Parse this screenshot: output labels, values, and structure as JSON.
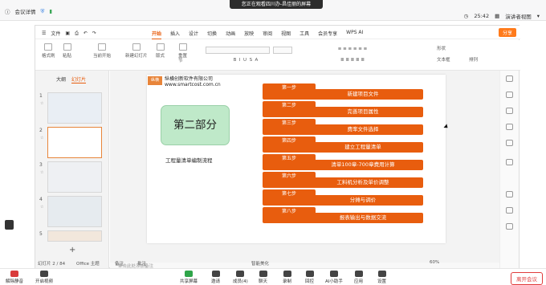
{
  "meeting": {
    "left_label": "会议详情",
    "banner": "您正在观看四川办-昌佳丽的屏幕",
    "time": "25:42",
    "view_label": "演讲者视图"
  },
  "menubar": {
    "file": "文件",
    "tabs": [
      "开始",
      "插入",
      "设计",
      "切换",
      "动画",
      "放映",
      "审阅",
      "视图",
      "工具",
      "会员专享",
      "WPS AI"
    ],
    "active_tab": "开始",
    "share": "分享"
  },
  "ribbon": {
    "groups": [
      "格式刷",
      "粘贴",
      "当前开始",
      "新建幻灯片",
      "版式",
      "节",
      "形状",
      "文本框",
      "排列"
    ],
    "reset": "重置"
  },
  "panel": {
    "tabs": [
      "大纲",
      "幻灯片"
    ],
    "active": "幻灯片",
    "slides": [
      "1",
      "2",
      "3",
      "4",
      "5"
    ]
  },
  "slide": {
    "logo": "纵横",
    "company": "纵横创新软件有限公司",
    "website": "www.smartcost.com.cn",
    "part_title": "第二部分",
    "flow_title": "工程量清单编制流程",
    "steps": [
      {
        "tag": "第一步",
        "text": "新建项目文件"
      },
      {
        "tag": "第二步",
        "text": "完善项目属性"
      },
      {
        "tag": "第三步",
        "text": "费率文件选择"
      },
      {
        "tag": "第四步",
        "text": "建立工程量清单"
      },
      {
        "tag": "第五步",
        "text": "清单100章-700章费用计算"
      },
      {
        "tag": "第六步",
        "text": "工料机分析及单价调整"
      },
      {
        "tag": "第七步",
        "text": "分摊与调价"
      },
      {
        "tag": "第八步",
        "text": "报表输出与数据交流"
      }
    ]
  },
  "notes_placeholder": "单击此处添加备注",
  "status": {
    "slide_info": "幻灯片 2 / 84",
    "theme": "Office 主题",
    "notes": "备注",
    "comment": "批注",
    "smart": "智能美化",
    "zoom": "60%"
  },
  "dock": {
    "items": [
      "解除静音",
      "开启视频",
      "共享屏幕",
      "邀请",
      "成员(4)",
      "聊天",
      "录制",
      "回控",
      "AI小助手",
      "应用",
      "设置"
    ],
    "leave": "离开会议"
  }
}
